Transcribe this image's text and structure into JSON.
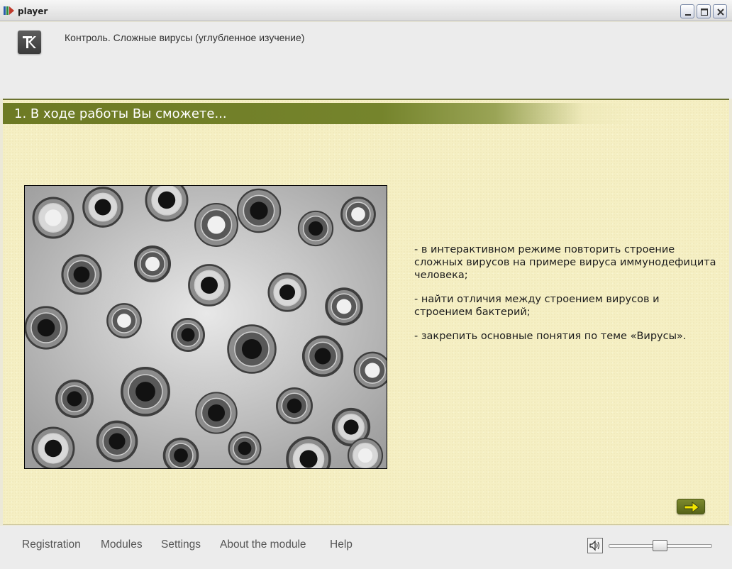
{
  "window": {
    "title": "player",
    "icon": "player-app-icon",
    "controls": [
      "minimize-icon",
      "maximize-icon",
      "close-icon"
    ]
  },
  "header": {
    "logo_icon": "k-logo-icon",
    "course_title": "Контроль. Сложные вирусы (углубленное изучение)"
  },
  "section": {
    "title": "1. В ходе работы Вы сможете..."
  },
  "main": {
    "image": "electron-micrograph-viruses",
    "goals": [
      "- в интерактивном режиме повторить строение сложных вирусов на примере вируса иммунодефицита человека;",
      "- найти отличия между строением вирусов и строением бактерий;",
      "- закрепить основные понятия по теме «Вирусы»."
    ],
    "next_icon": "arrow-right-icon"
  },
  "footer": {
    "menu": [
      "Registration",
      "Modules",
      "Settings",
      "About the module",
      "Help"
    ],
    "speaker_icon": "speaker-icon",
    "volume_level": 0.45
  },
  "colors": {
    "content_bg": "#f5efc3",
    "section_bar": "#6d7a24",
    "arrow": "#f2e600"
  }
}
